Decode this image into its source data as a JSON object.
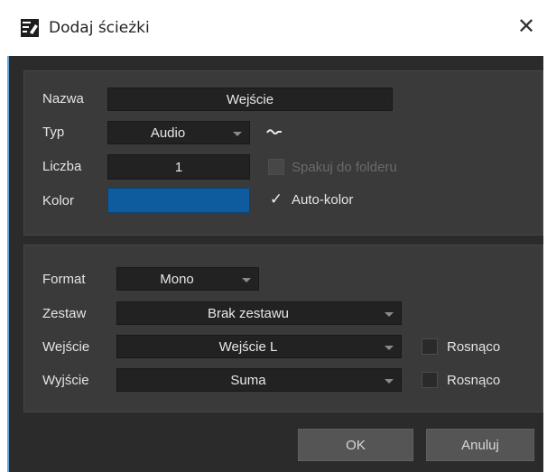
{
  "window": {
    "title": "Dodaj ścieżki",
    "title_icon": "add-track-icon",
    "close_icon": "close-icon",
    "close_glyph": "✕"
  },
  "track": {
    "name_label": "Nazwa",
    "name_value": "Wejście",
    "type_label": "Typ",
    "type_value": "Audio",
    "type_icon": "audio-wave-icon",
    "count_label": "Liczba",
    "count_value": "1",
    "pack_label": "Spakuj do folderu",
    "pack_checked": false,
    "pack_enabled": false,
    "color_label": "Kolor",
    "color_value": "#0e5b9e",
    "autocolor_label": "Auto-kolor",
    "autocolor_checked": true
  },
  "io": {
    "format_label": "Format",
    "format_value": "Mono",
    "preset_label": "Zestaw",
    "preset_value": "Brak zestawu",
    "input_label": "Wejście",
    "input_value": "Wejście L",
    "input_ascending_label": "Rosnąco",
    "input_ascending_checked": false,
    "output_label": "Wyjście",
    "output_value": "Suma",
    "output_ascending_label": "Rosnąco",
    "output_ascending_checked": false
  },
  "buttons": {
    "ok": "OK",
    "cancel": "Anuluj"
  },
  "colors": {
    "body_bg": "#2b2b2b",
    "panel_bg": "#3a3a3a",
    "field_bg": "#222222",
    "accent": "#6aa6d8"
  }
}
